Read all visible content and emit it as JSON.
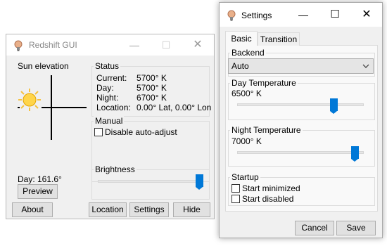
{
  "redshift": {
    "title": "Redshift GUI",
    "sun_elevation_label": "Sun elevation",
    "day_elevation": "Day: 161.6°",
    "preview_label": "Preview",
    "status": {
      "group_label": "Status",
      "rows": [
        {
          "key": "Current:",
          "value": "5700° K"
        },
        {
          "key": "Day:",
          "value": "5700° K"
        },
        {
          "key": "Night:",
          "value": "6700° K"
        },
        {
          "key": "Location:",
          "value": "0.00° Lat, 0.00° Lon"
        }
      ]
    },
    "manual": {
      "group_label": "Manual",
      "disable_auto_adjust_label": "Disable auto-adjust",
      "disable_auto_adjust_checked": false
    },
    "brightness": {
      "group_label": "Brightness",
      "level_percent": 100
    },
    "buttons": {
      "about": "About",
      "location": "Location",
      "settings": "Settings",
      "hide": "Hide"
    }
  },
  "settings": {
    "title": "Settings",
    "tabs": [
      {
        "label": "Basic",
        "active": true
      },
      {
        "label": "Transition",
        "active": false
      }
    ],
    "backend": {
      "group_label": "Backend",
      "selected": "Auto"
    },
    "day_temperature": {
      "group_label": "Day Temperature",
      "value": "6500° K",
      "level_percent": 78
    },
    "night_temperature": {
      "group_label": "Night Temperature",
      "value": "7000° K",
      "level_percent": 96
    },
    "startup": {
      "group_label": "Startup",
      "start_minimized_label": "Start minimized",
      "start_minimized_checked": false,
      "start_disabled_label": "Start disabled",
      "start_disabled_checked": false
    },
    "buttons": {
      "cancel": "Cancel",
      "save": "Save"
    }
  },
  "colors": {
    "accent": "#0078d7",
    "window_bg": "#f0f0f0",
    "button_bg": "#e1e1e1"
  }
}
